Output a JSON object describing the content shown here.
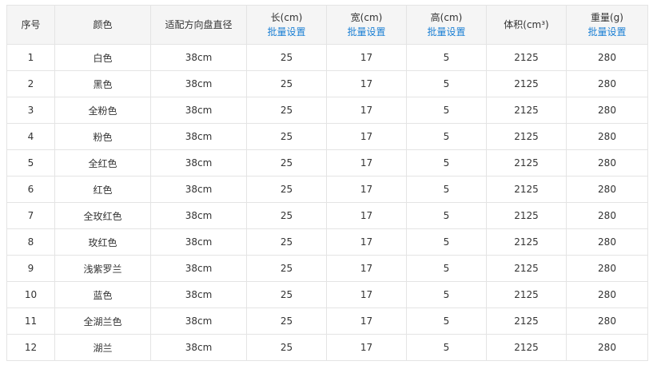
{
  "table": {
    "headers": [
      {
        "label": "序号",
        "link": ""
      },
      {
        "label": "颜色",
        "link": ""
      },
      {
        "label": "适配方向盘直径",
        "link": ""
      },
      {
        "label": "长(cm)",
        "link": "批量设置"
      },
      {
        "label": "宽(cm)",
        "link": "批量设置"
      },
      {
        "label": "高(cm)",
        "link": "批量设置"
      },
      {
        "label": "体积(cm³)",
        "link": ""
      },
      {
        "label": "重量(g)",
        "link": "批量设置"
      }
    ],
    "rows": [
      [
        "1",
        "白色",
        "38cm",
        "25",
        "17",
        "5",
        "2125",
        "280"
      ],
      [
        "2",
        "黑色",
        "38cm",
        "25",
        "17",
        "5",
        "2125",
        "280"
      ],
      [
        "3",
        "全粉色",
        "38cm",
        "25",
        "17",
        "5",
        "2125",
        "280"
      ],
      [
        "4",
        "粉色",
        "38cm",
        "25",
        "17",
        "5",
        "2125",
        "280"
      ],
      [
        "5",
        "全红色",
        "38cm",
        "25",
        "17",
        "5",
        "2125",
        "280"
      ],
      [
        "6",
        "红色",
        "38cm",
        "25",
        "17",
        "5",
        "2125",
        "280"
      ],
      [
        "7",
        "全玫红色",
        "38cm",
        "25",
        "17",
        "5",
        "2125",
        "280"
      ],
      [
        "8",
        "玫红色",
        "38cm",
        "25",
        "17",
        "5",
        "2125",
        "280"
      ],
      [
        "9",
        "浅紫罗兰",
        "38cm",
        "25",
        "17",
        "5",
        "2125",
        "280"
      ],
      [
        "10",
        "蓝色",
        "38cm",
        "25",
        "17",
        "5",
        "2125",
        "280"
      ],
      [
        "11",
        "全湖兰色",
        "38cm",
        "25",
        "17",
        "5",
        "2125",
        "280"
      ],
      [
        "12",
        "湖兰",
        "38cm",
        "25",
        "17",
        "5",
        "2125",
        "280"
      ]
    ]
  },
  "colors": {
    "link": "#1a7fd4",
    "header_bg": "#f5f5f5",
    "border": "#e4e4e4",
    "text": "#333333"
  }
}
